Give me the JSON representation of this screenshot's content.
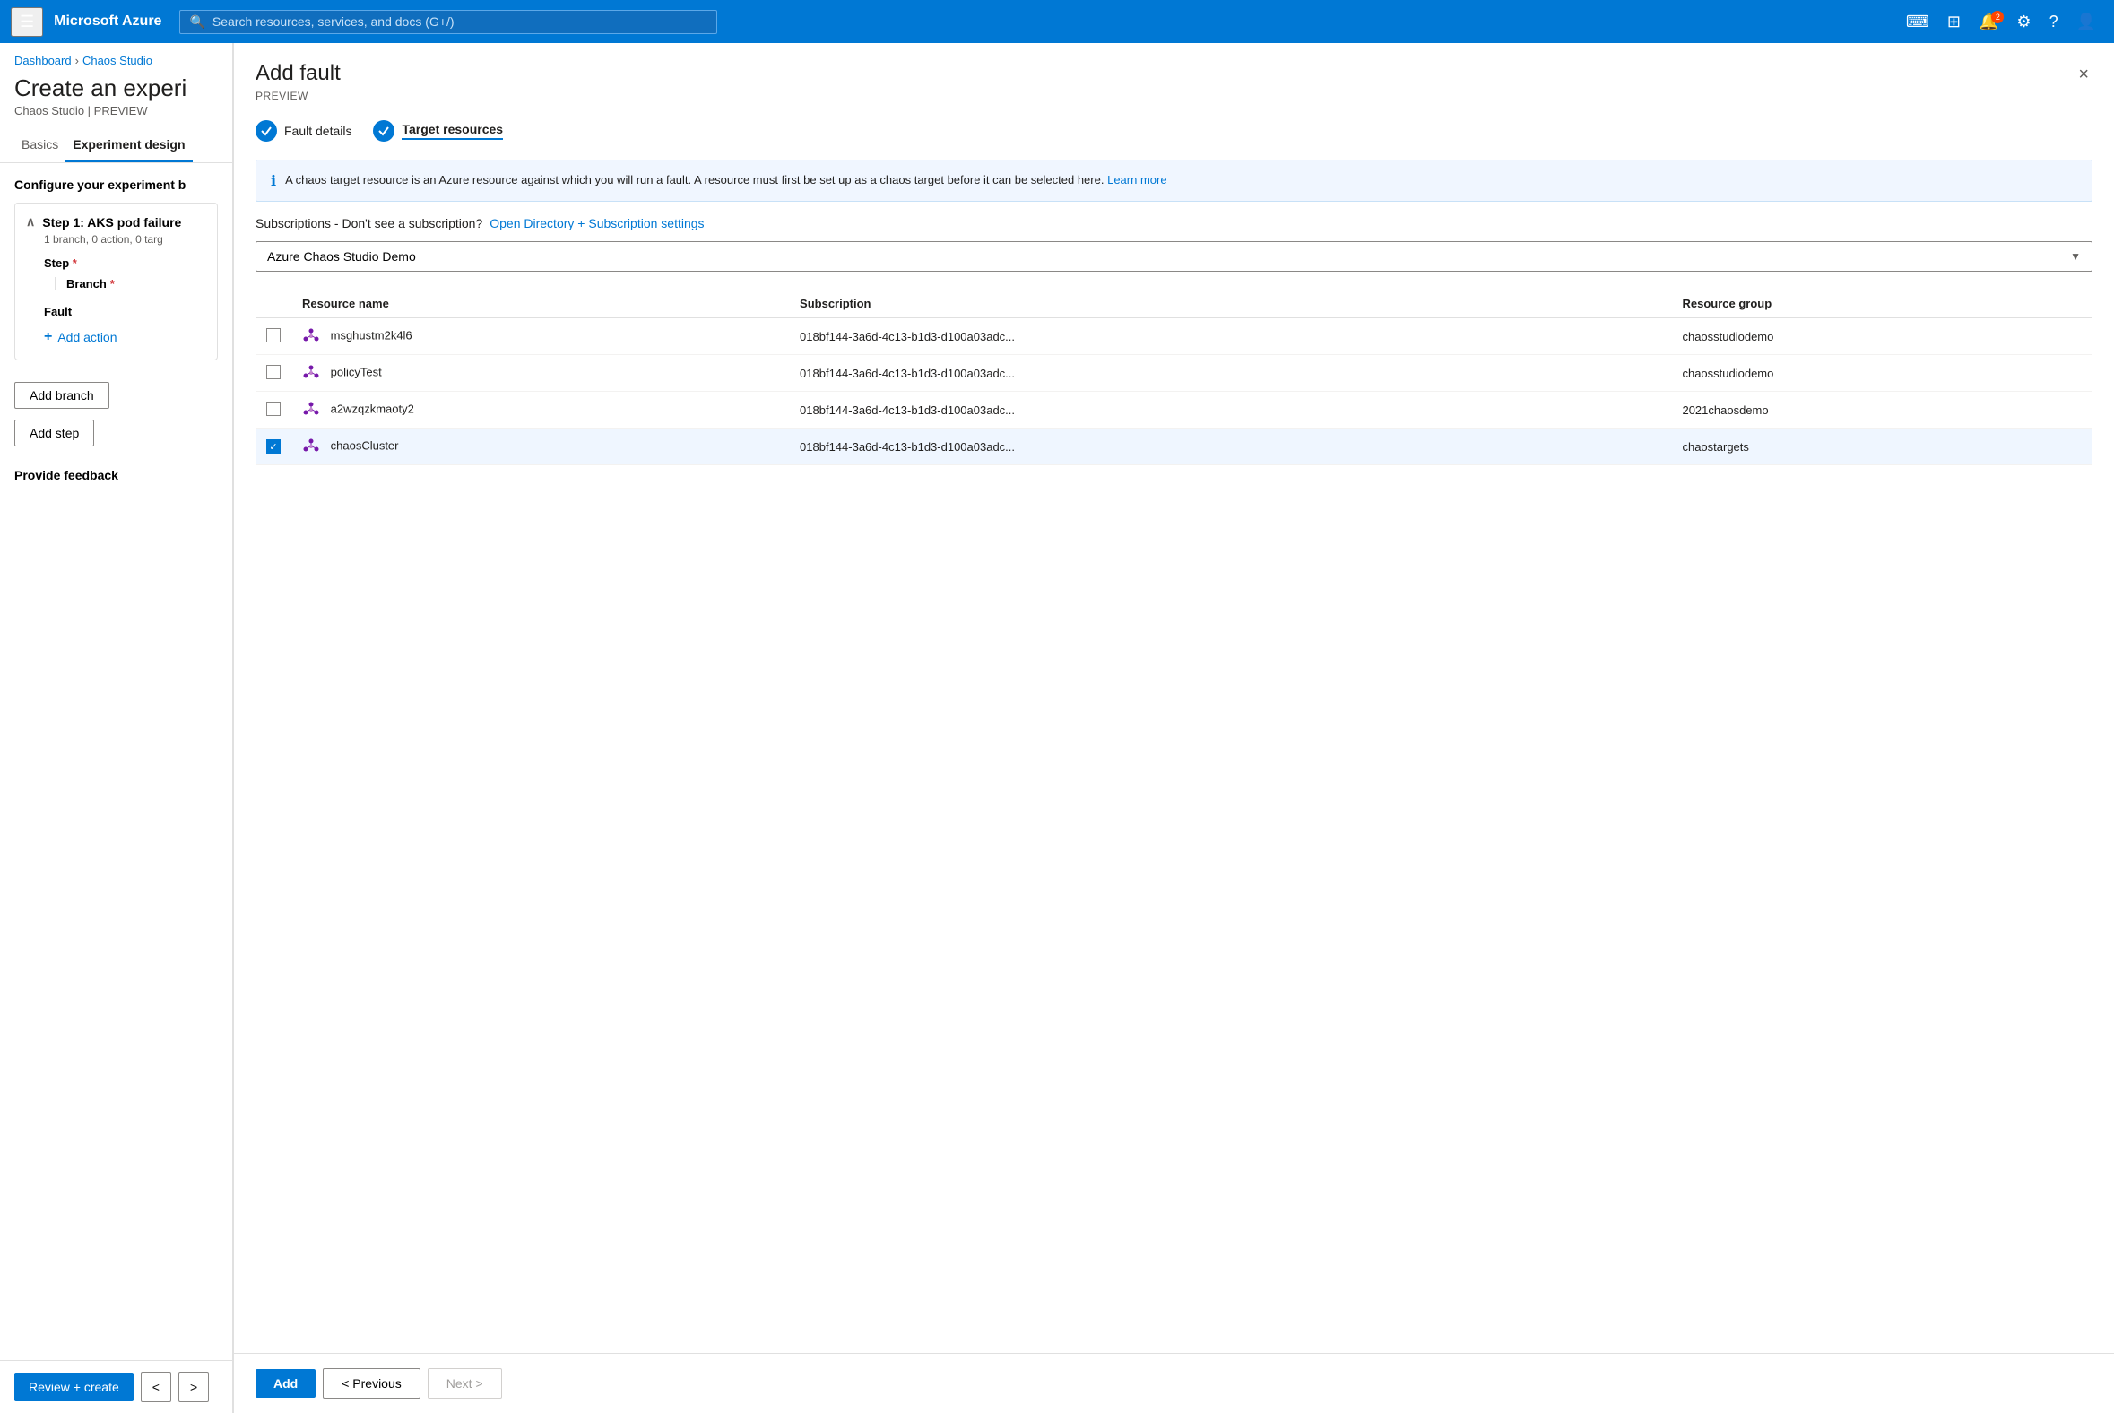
{
  "topbar": {
    "logo": "Microsoft Azure",
    "search_placeholder": "Search resources, services, and docs (G+/)",
    "notification_count": "2"
  },
  "breadcrumb": {
    "items": [
      "Dashboard",
      "Chaos Studio"
    ]
  },
  "page": {
    "title": "Create an experi",
    "subtitle": "Chaos Studio | PREVIEW"
  },
  "tabs": [
    {
      "label": "Basics",
      "active": false
    },
    {
      "label": "Experiment design",
      "active": true
    }
  ],
  "left": {
    "configure_title": "Configure your experiment b",
    "step": {
      "title": "Step 1: AKS pod failure",
      "info": "1 branch, 0 action, 0 targ"
    },
    "step_label": "Step",
    "branch_label": "Branch",
    "fault_label": "Fault",
    "add_action_label": "Add action",
    "add_branch_label": "Add branch",
    "add_step_label": "Add step",
    "provide_feedback_label": "Provide feedback"
  },
  "bottom_nav": {
    "review_create": "Review + create",
    "previous": "<",
    "next": ">"
  },
  "panel": {
    "title": "Add fault",
    "subtitle": "PREVIEW",
    "close_label": "×"
  },
  "wizard": {
    "steps": [
      {
        "label": "Fault details",
        "active": false,
        "completed": true
      },
      {
        "label": "Target resources",
        "active": true,
        "completed": true
      }
    ]
  },
  "info_box": {
    "text": "A chaos target resource is an Azure resource against which you will run a fault. A resource must first be set up as a chaos target before it can be selected here.",
    "link_label": "Learn more"
  },
  "subscription": {
    "label": "Subscriptions - Don't see a subscription?",
    "link_label": "Open Directory + Subscription settings",
    "selected": "Azure Chaos Studio Demo"
  },
  "table": {
    "columns": [
      "Resource name",
      "Subscription",
      "Resource group"
    ],
    "rows": [
      {
        "name": "msghustm2k4l6",
        "subscription": "018bf144-3a6d-4c13-b1d3-d100a03adc...",
        "resource_group": "chaosstudiodemo",
        "selected": false
      },
      {
        "name": "policyTest",
        "subscription": "018bf144-3a6d-4c13-b1d3-d100a03adc...",
        "resource_group": "chaosstudiodemo",
        "selected": false
      },
      {
        "name": "a2wzqzkmaoty2",
        "subscription": "018bf144-3a6d-4c13-b1d3-d100a03adc...",
        "resource_group": "2021chaosdemo",
        "selected": false
      },
      {
        "name": "chaosCluster",
        "subscription": "018bf144-3a6d-4c13-b1d3-d100a03adc...",
        "resource_group": "chaostargets",
        "selected": true
      }
    ]
  },
  "footer": {
    "add_label": "Add",
    "previous_label": "< Previous",
    "next_label": "Next >"
  }
}
